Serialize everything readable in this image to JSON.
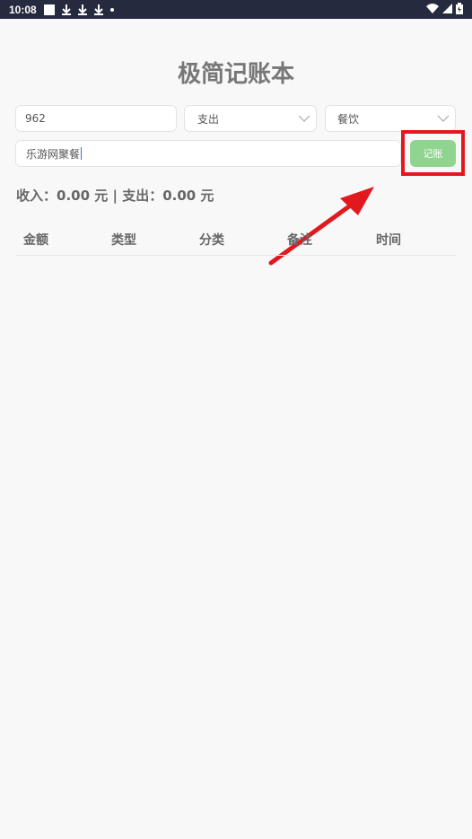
{
  "status_bar": {
    "time": "10:08"
  },
  "app": {
    "title": "极简记账本"
  },
  "form": {
    "amount_value": "962",
    "type_value": "支出",
    "category_value": "餐饮",
    "note_value": "乐游网聚餐",
    "submit_label": "记账"
  },
  "summary": {
    "income_label": "收入：",
    "income_value": "0.00 元",
    "separator": " | ",
    "expense_label": "支出：",
    "expense_value": "0.00 元"
  },
  "table": {
    "headers": [
      "金额",
      "类型",
      "分类",
      "备注",
      "时间"
    ]
  },
  "colors": {
    "accent_green": "#8fd48f",
    "highlight_red": "#e1191f",
    "status_bar": "#262a3e"
  }
}
